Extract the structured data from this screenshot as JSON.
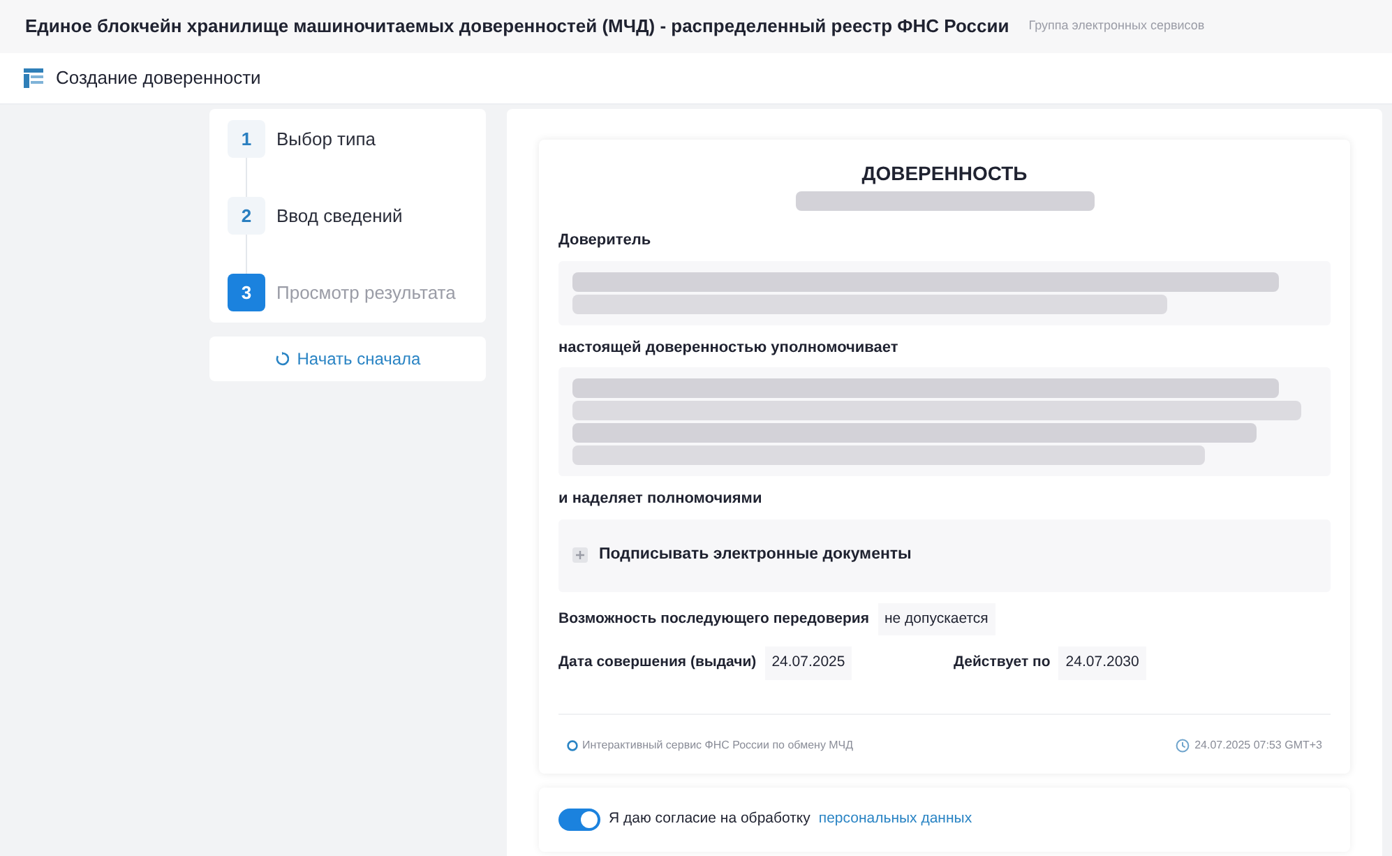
{
  "header": {
    "title": "Единое блокчейн хранилище машиночитаемых доверенностей (МЧД) - распределенный реестр ФНС России",
    "subtitle": "Группа электронных сервисов"
  },
  "page_title": "Создание доверенности",
  "steps": [
    {
      "number": "1",
      "label": "Выбор типа",
      "selected": false
    },
    {
      "number": "2",
      "label": "Ввод сведений",
      "selected": false
    },
    {
      "number": "3",
      "label": "Просмотр результата",
      "selected": true
    }
  ],
  "restart_button": "Начать сначала",
  "document": {
    "title": "ДОВЕРЕННОСТЬ",
    "grantor_label": "Доверитель",
    "authorizes_label": "настоящей доверенностью уполномочивает",
    "powers_label": "и наделяет полномочиями",
    "powers": [
      {
        "label": "Подписывать электронные документы"
      }
    ],
    "redelegation_label": "Возможность последующего передоверия",
    "redelegation_value": "не допускается",
    "issue_date_label": "Дата совершения (выдачи)",
    "issue_date": "24.07.2025",
    "valid_until_label": "Действует по",
    "valid_until": "24.07.2030",
    "footer_service": "Интерактивный сервис ФНС России по обмену МЧД",
    "footer_time": "24.07.2025 07:53 GMT+3"
  },
  "consent": {
    "on": true,
    "text": "Я даю согласие на обработку",
    "link": "персональных данных"
  }
}
